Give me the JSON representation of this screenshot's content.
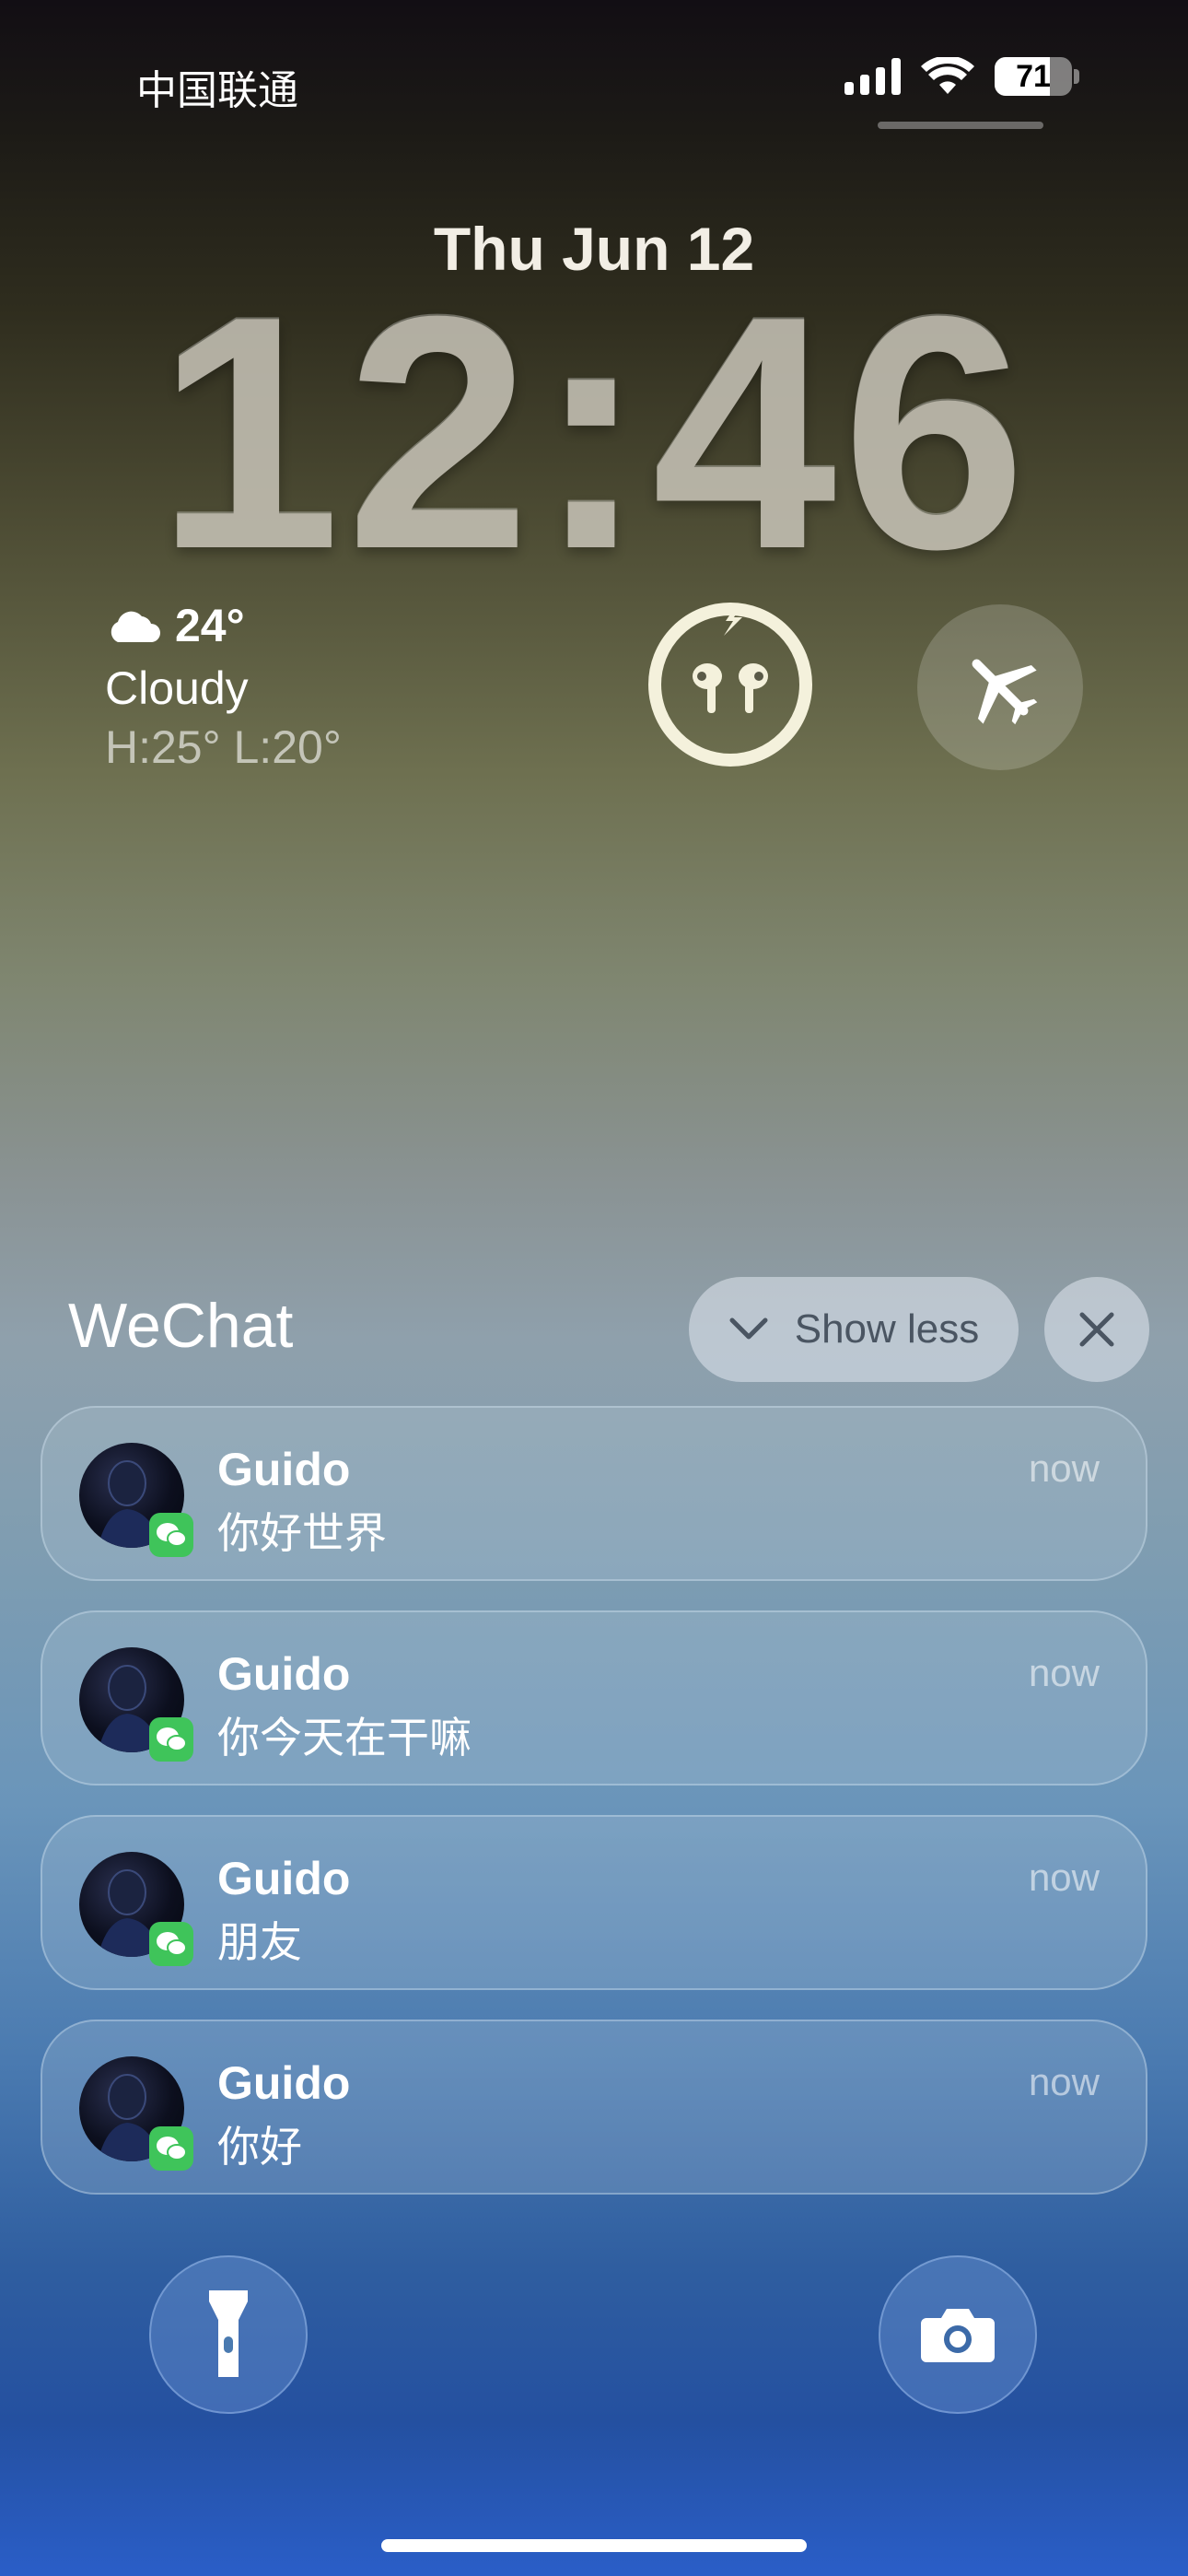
{
  "status_bar": {
    "carrier": "中国联通",
    "battery_percent": "71",
    "battery_level": 0.71
  },
  "lock": {
    "date": "Thu Jun 12",
    "time": "12:46"
  },
  "weather": {
    "temp": "24°",
    "condition": "Cloudy",
    "high_low": "H:25° L:20°",
    "icon": "cloud-icon"
  },
  "widgets": {
    "airpods_icon": "airpods-charging-icon",
    "airplane_icon": "airplane-icon"
  },
  "notification_group": {
    "app": "WeChat",
    "show_less_label": "Show less",
    "items": [
      {
        "sender": "Guido",
        "message": "你好世界",
        "time": "now"
      },
      {
        "sender": "Guido",
        "message": "你今天在干嘛",
        "time": "now"
      },
      {
        "sender": "Guido",
        "message": "朋友",
        "time": "now"
      },
      {
        "sender": "Guido",
        "message": "你好",
        "time": "now"
      }
    ]
  },
  "quick_actions": {
    "left": "flashlight-icon",
    "right": "camera-icon"
  },
  "colors": {
    "wechat_green": "#3fc45a",
    "time_color": "#c9c5b9"
  }
}
